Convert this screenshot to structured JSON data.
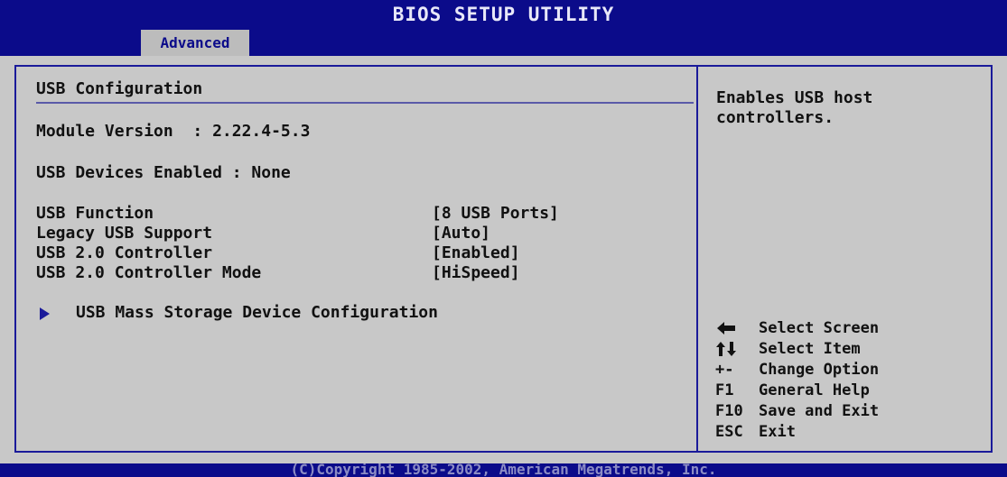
{
  "header": {
    "title": "BIOS SETUP UTILITY",
    "active_tab": "Advanced"
  },
  "main": {
    "section_title": "USB Configuration",
    "module_version": "Module Version  : 2.22.4-5.3",
    "devices_enabled": "USB Devices Enabled : None",
    "settings": [
      {
        "label": "USB Function",
        "value": "[8 USB Ports]"
      },
      {
        "label": "Legacy USB Support",
        "value": "[Auto]"
      },
      {
        "label": "USB 2.0 Controller",
        "value": "[Enabled]"
      },
      {
        "label": "USB 2.0 Controller Mode",
        "value": "[HiSpeed]"
      }
    ],
    "submenu": {
      "label": "USB Mass Storage Device Configuration",
      "icon": "submenu-arrow-icon"
    }
  },
  "help": {
    "line1": "Enables USB host",
    "line2": "controllers."
  },
  "keys": [
    {
      "key": "",
      "icon": "left-right-arrow-icon",
      "desc": "Select Screen"
    },
    {
      "key": "",
      "icon": "up-down-arrow-icon",
      "desc": "Select Item"
    },
    {
      "key": "+-",
      "desc": "Change Option"
    },
    {
      "key": "F1",
      "desc": "General Help"
    },
    {
      "key": "F10",
      "desc": "Save and Exit"
    },
    {
      "key": "ESC",
      "desc": "Exit"
    }
  ],
  "footer": {
    "copyright": "(C)Copyright 1985-2002, American Megatrends, Inc."
  },
  "colors": {
    "header_bg": "#0b0b8a",
    "panel_bg": "#c8c8c8",
    "frame": "#1a1a9a",
    "text": "#111111"
  }
}
